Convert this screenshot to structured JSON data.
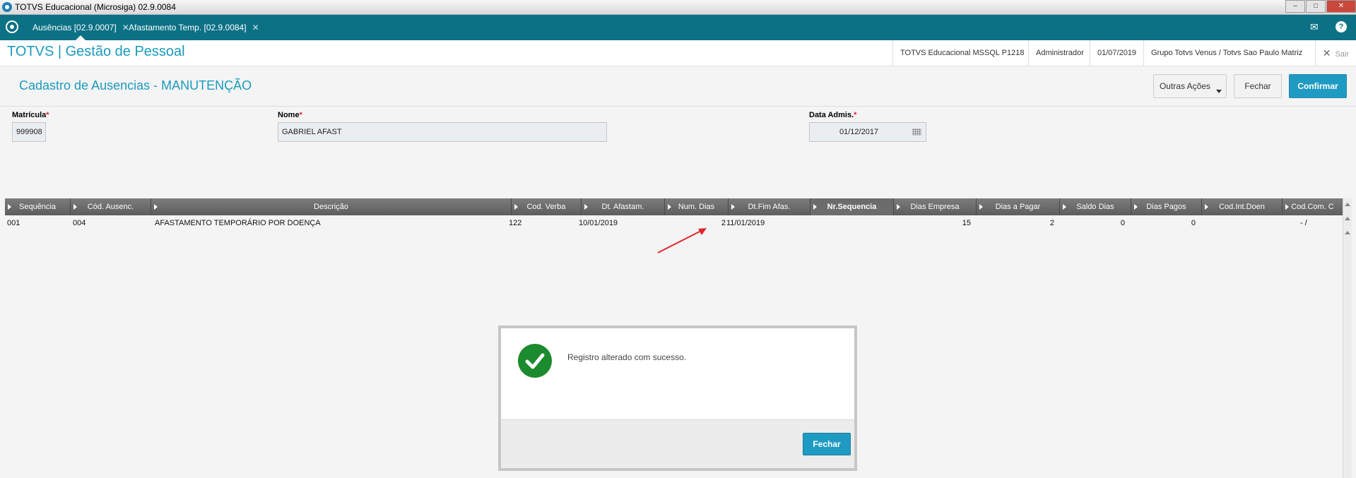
{
  "window": {
    "title": "TOTVS Educacional (Microsiga) 02.9.0084"
  },
  "tabs": [
    {
      "label": "Ausências [02.9.0007]"
    },
    {
      "label": "Afastamento Temp. [02.9.0084]"
    }
  ],
  "header": {
    "brand": "TOTVS | Gestão de Pessoal",
    "environment": "TOTVS Educacional MSSQL P1218",
    "user": "Administrador",
    "date": "01/07/2019",
    "company": "Grupo Totvs Venus / Totvs Sao Paulo Matriz",
    "exit_label": "Sair"
  },
  "page": {
    "title": "Cadastro de Ausencias - MANUTENÇÃO",
    "actions": {
      "other": "Outras Ações",
      "close": "Fechar",
      "confirm": "Confirmar"
    }
  },
  "form": {
    "matricula": {
      "label": "Matrícula",
      "value": "999908"
    },
    "nome": {
      "label": "Nome",
      "value": "GABRIEL AFAST"
    },
    "data_admis": {
      "label": "Data Admis.",
      "value": "01/12/2017"
    }
  },
  "grid": {
    "columns": [
      "Sequência",
      "Cód. Ausenc.",
      "Descrição",
      "Cod. Verba",
      "Dt. Afastam.",
      "Num. Dias",
      "Dt.Fim Afas.",
      "Nr.Sequencia",
      "Dias Empresa",
      "Dias a Pagar",
      "Saldo Dias",
      "Dias Pagos",
      "Cod.Int.Doen",
      "Cod.Com. C"
    ],
    "rows": [
      [
        "001",
        "004",
        "AFASTAMENTO TEMPORÁRIO POR DOENÇA",
        "122",
        "10/01/2019",
        "2",
        "11/01/2019",
        "",
        "15",
        "2",
        "0",
        "0",
        "",
        "- /"
      ]
    ]
  },
  "dialog": {
    "message": "Registro alterado com sucesso.",
    "button": "Fechar"
  },
  "colors": {
    "accent": "#1a9bbd",
    "tabbar": "#0c7185",
    "success": "#1c8a2e",
    "annotation": "#e0262d"
  }
}
